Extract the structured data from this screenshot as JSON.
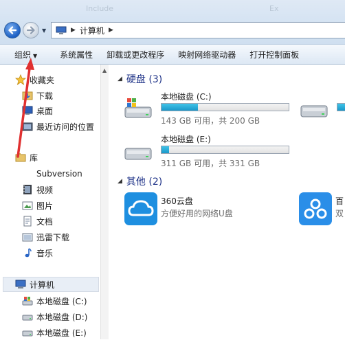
{
  "title_ghost": {
    "left": "Include",
    "right": "Ex"
  },
  "address": {
    "crumb": "计算机"
  },
  "toolbar": {
    "organize": "组织",
    "system_properties": "系统属性",
    "uninstall": "卸载或更改程序",
    "map_drive": "映射网络驱动器",
    "control_panel": "打开控制面板"
  },
  "sidebar": {
    "favorites": "收藏夹",
    "downloads": "下载",
    "desktop": "桌面",
    "recent": "最近访问的位置",
    "libraries": "库",
    "subversion": "Subversion",
    "videos": "视频",
    "pictures": "图片",
    "documents": "文档",
    "thunder": "迅雷下载",
    "music": "音乐",
    "computer": "计算机",
    "drive_c": "本地磁盘 (C:)",
    "drive_d": "本地磁盘 (D:)",
    "drive_e": "本地磁盘 (E:)"
  },
  "groups": {
    "hard_disks": "硬盘 (3)",
    "others": "其他 (2)"
  },
  "drives": [
    {
      "name": "本地磁盘 (C:)",
      "info": "143 GB 可用，共 200 GB",
      "used_fraction": 0.285
    },
    {
      "name": "本地磁盘 (E:)",
      "info": "311 GB 可用，共 331 GB",
      "used_fraction": 0.06
    }
  ],
  "apps": [
    {
      "name": "360云盘",
      "desc": "方便好用的网络U盘"
    },
    {
      "name": "百",
      "desc": "双"
    }
  ],
  "colors": {
    "accent_blue": "#1e3287",
    "usage_bar": "#1a98c9",
    "annotation_arrow": "#e03030"
  }
}
